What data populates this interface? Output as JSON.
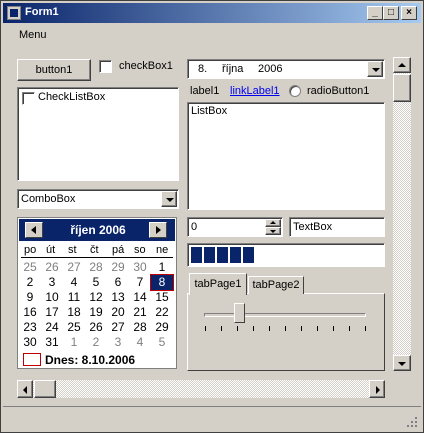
{
  "window": {
    "title": "Form1",
    "controls": {
      "minimize": "_",
      "maximize": "□",
      "close": "×"
    }
  },
  "menu": {
    "items": [
      "Menu"
    ]
  },
  "button1": {
    "label": "button1"
  },
  "checkBox1": {
    "label": "checkBox1",
    "checked": false
  },
  "checkListBox": {
    "items": [
      "CheckListBox"
    ]
  },
  "comboBox": {
    "value": "ComboBox"
  },
  "datePicker": {
    "day": "8.",
    "month": "října",
    "year": "2006"
  },
  "label1": "label1",
  "linkLabel1": "linkLabel1",
  "radioButton1": {
    "label": "radioButton1",
    "checked": false
  },
  "listBox": {
    "items": [
      "ListBox"
    ]
  },
  "numeric": {
    "value": "0"
  },
  "textBox": {
    "value": "TextBox"
  },
  "progress": {
    "value": 0.3
  },
  "tabs": [
    {
      "label": "tabPage1",
      "active": true
    },
    {
      "label": "tabPage2",
      "active": false
    }
  ],
  "trackBar": {
    "value": 2,
    "min": 0,
    "max": 10
  },
  "calendar": {
    "title": "říjen 2006",
    "day_names": [
      "po",
      "út",
      "st",
      "čt",
      "pá",
      "so",
      "ne"
    ],
    "weeks": [
      [
        "25",
        "26",
        "27",
        "28",
        "29",
        "30",
        "1"
      ],
      [
        "2",
        "3",
        "4",
        "5",
        "6",
        "7",
        "8"
      ],
      [
        "9",
        "10",
        "11",
        "12",
        "13",
        "14",
        "15"
      ],
      [
        "16",
        "17",
        "18",
        "19",
        "20",
        "21",
        "22"
      ],
      [
        "23",
        "24",
        "25",
        "26",
        "27",
        "28",
        "29"
      ],
      [
        "30",
        "31",
        "1",
        "2",
        "3",
        "4",
        "5"
      ]
    ],
    "other_month": [
      [
        0,
        0
      ],
      [
        0,
        1
      ],
      [
        0,
        2
      ],
      [
        0,
        3
      ],
      [
        0,
        4
      ],
      [
        0,
        5
      ],
      [
        5,
        2
      ],
      [
        5,
        3
      ],
      [
        5,
        4
      ],
      [
        5,
        5
      ],
      [
        5,
        6
      ]
    ],
    "selected": [
      1,
      6
    ],
    "today_label": "Dnes: 8.10.2006"
  },
  "colors": {
    "title_dark": "#0a246a",
    "title_light": "#a6caf0",
    "face": "#d4d0c8",
    "link": "#0000ee",
    "selected": "#0a246a",
    "today_box": "#c00000"
  }
}
